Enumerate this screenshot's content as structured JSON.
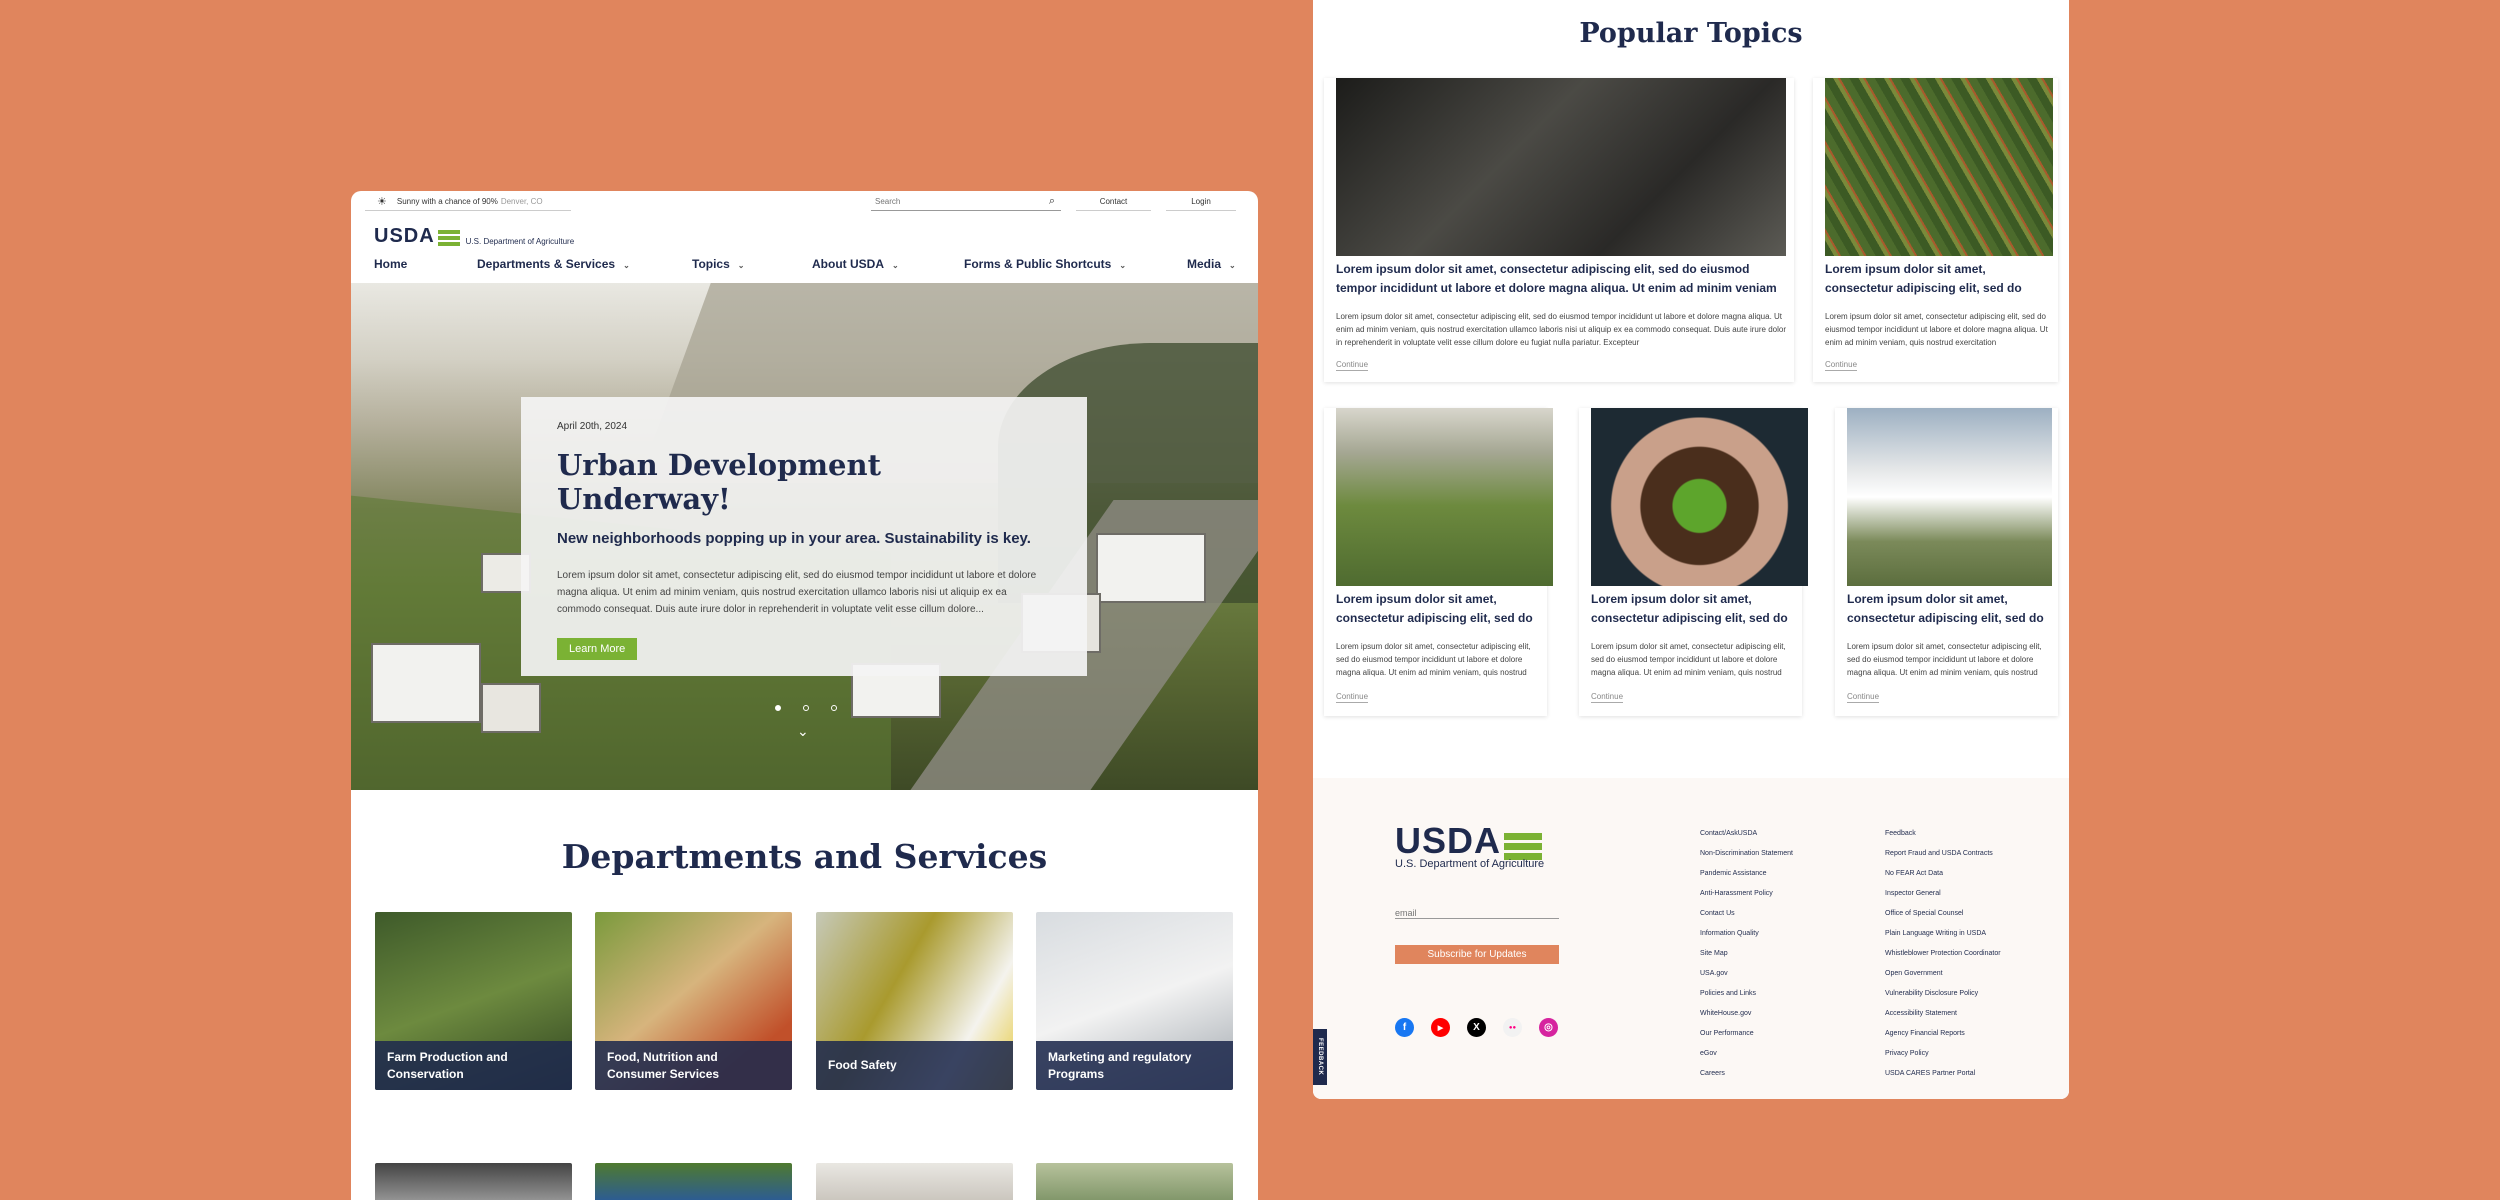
{
  "left": {
    "topbar": {
      "weather_icon": "sun-icon",
      "weather_text": "Sunny with a chance of 90%",
      "weather_location": "Denver, CO",
      "search_placeholder": "Search",
      "contact_label": "Contact",
      "login_label": "Login"
    },
    "logo": {
      "word": "USDA",
      "subtitle": "U.S. Department of Agriculture"
    },
    "nav": [
      {
        "label": "Home",
        "dropdown": false
      },
      {
        "label": "Departments & Services",
        "dropdown": true
      },
      {
        "label": "Topics",
        "dropdown": true
      },
      {
        "label": "About USDA",
        "dropdown": true
      },
      {
        "label": "Forms & Public Shortcuts",
        "dropdown": true
      },
      {
        "label": "Media",
        "dropdown": true
      }
    ],
    "hero": {
      "date": "April 20th, 2024",
      "title": "Urban Development Underway!",
      "subtitle": "New neighborhoods popping up in your area. Sustainability is key.",
      "body": "Lorem ipsum dolor sit amet, consectetur adipiscing elit, sed do eiusmod tempor incididunt ut labore et dolore magna aliqua. Ut enim ad minim veniam, quis nostrud exercitation ullamco laboris nisi ut aliquip ex ea commodo consequat. Duis aute irure dolor in reprehenderit in voluptate velit esse cillum dolore...",
      "button": "Learn More",
      "slide_count": 3,
      "active_slide": 1
    },
    "departments_title": "Departments and Services",
    "departments": [
      {
        "label": "Farm Production and Conservation"
      },
      {
        "label": "Food, Nutrition and Consumer Services"
      },
      {
        "label": "Food Safety"
      },
      {
        "label": "Marketing and regulatory Programs"
      }
    ]
  },
  "right": {
    "title": "Popular Topics",
    "cards": [
      {
        "title": "Lorem ipsum dolor sit amet, consectetur adipiscing elit, sed do eiusmod tempor incididunt ut labore et dolore magna aliqua. Ut enim ad minim veniam",
        "body": "Lorem ipsum dolor sit amet, consectetur adipiscing elit, sed do eiusmod tempor incididunt ut labore et dolore magna aliqua. Ut enim ad minim veniam, quis nostrud exercitation ullamco laboris nisi ut aliquip ex ea commodo consequat. Duis aute irure dolor in reprehenderit in voluptate velit esse cillum dolore eu fugiat nulla pariatur. Excepteur",
        "link": "Continue"
      },
      {
        "title": "Lorem ipsum dolor sit amet, consectetur adipiscing elit, sed do eiusmod",
        "body": "Lorem ipsum dolor sit amet, consectetur adipiscing elit, sed do eiusmod tempor incididunt ut labore et dolore magna aliqua. Ut enim ad minim veniam, quis nostrud exercitation",
        "link": "Continue"
      },
      {
        "title": "Lorem ipsum dolor sit amet, consectetur adipiscing elit, sed do eiusmod",
        "body": "Lorem ipsum dolor sit amet, consectetur adipiscing elit, sed do eiusmod tempor incididunt ut labore et dolore magna aliqua. Ut enim ad minim veniam, quis nostrud",
        "link": "Continue"
      },
      {
        "title": "Lorem ipsum dolor sit amet, consectetur adipiscing elit, sed do eiusmod",
        "body": "Lorem ipsum dolor sit amet, consectetur adipiscing elit, sed do eiusmod tempor incididunt ut labore et dolore magna aliqua. Ut enim ad minim veniam, quis nostrud",
        "link": "Continue"
      },
      {
        "title": "Lorem ipsum dolor sit amet, consectetur adipiscing elit, sed do eiusmod",
        "body": "Lorem ipsum dolor sit amet, consectetur adipiscing elit, sed do eiusmod tempor incididunt ut labore et dolore magna aliqua. Ut enim ad minim veniam, quis nostrud",
        "link": "Continue"
      }
    ],
    "footer": {
      "logo_word": "USDA",
      "logo_subtitle": "U.S. Department of Agriculture",
      "email_placeholder": "email",
      "subscribe": "Subscribe for Updates",
      "social": [
        {
          "icon": "facebook-icon",
          "glyph": "f",
          "color": "#1877f2"
        },
        {
          "icon": "youtube-icon",
          "glyph": "▶",
          "color": "#ff0000"
        },
        {
          "icon": "x-icon",
          "glyph": "X",
          "color": "#000000"
        },
        {
          "icon": "flickr-icon",
          "glyph": "●●",
          "color": "#f2f2f2"
        },
        {
          "icon": "instagram-icon",
          "glyph": "◎",
          "color": "#d6249f"
        }
      ],
      "links_col1": [
        "Contact/AskUSDA",
        "Non-Discrimination Statement",
        "Pandemic Assistance",
        "Anti-Harassment Policy",
        "Contact Us",
        "Information Quality",
        "Site Map",
        "USA.gov",
        "Policies and Links",
        "WhiteHouse.gov",
        "Our Performance",
        "eGov",
        "Careers"
      ],
      "links_col2": [
        "Feedback",
        "Report Fraud and USDA Contracts",
        "No FEAR Act Data",
        "Inspector General",
        "Office of Special Counsel",
        "Plain Language Writing in USDA",
        "Whistleblower Protection Coordinator",
        "Open Government",
        "Vulnerability Disclosure Policy",
        "Accessibility Statement",
        "Agency Financial Reports",
        "Privacy Policy",
        "USDA CARES Partner Portal"
      ],
      "feedback_tab": "FEEDBACK"
    }
  },
  "colors": {
    "background": "#e0855d",
    "navy": "#1f2a4d",
    "green": "#7bb234",
    "orange": "#e0855d"
  }
}
